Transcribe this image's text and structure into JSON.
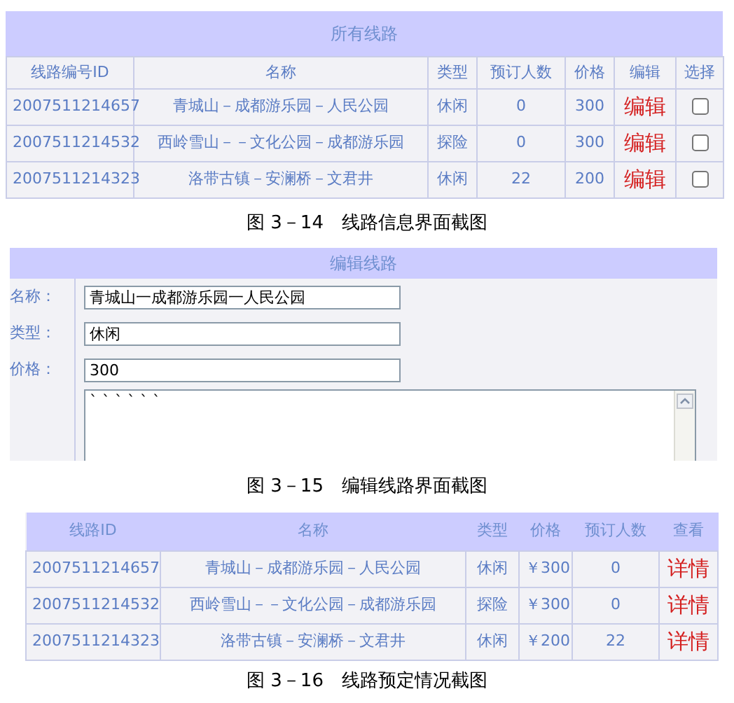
{
  "routes_panel": {
    "title": "所有线路",
    "columns": [
      "线路编号ID",
      "名称",
      "类型",
      "预订人数",
      "价格",
      "编辑",
      "选择"
    ],
    "rows": [
      {
        "id": "2007511214657",
        "name": "青城山－成都游乐园－人民公园",
        "type": "休闲",
        "count": "0",
        "price": "300",
        "action": "编辑",
        "checked": false
      },
      {
        "id": "2007511214532",
        "name": "西岭雪山－－文化公园－成都游乐园",
        "type": "探险",
        "count": "0",
        "price": "300",
        "action": "编辑",
        "checked": false
      },
      {
        "id": "2007511214323",
        "name": "洛带古镇－安澜桥－文君井",
        "type": "休闲",
        "count": "22",
        "price": "200",
        "action": "编辑",
        "checked": false
      }
    ]
  },
  "routes_caption": "图 3－14　线路信息界面截图",
  "edit_panel": {
    "title": "编辑线路",
    "fields": [
      {
        "label": "名称：",
        "value": "青城山一成都游乐园一人民公园"
      },
      {
        "label": "类型：",
        "value": "休闲"
      },
      {
        "label": "价格：",
        "value": "300"
      }
    ],
    "description": "` ` ` ` ` `"
  },
  "edit_caption": "图 3－15　编辑线路界面截图",
  "booking_panel": {
    "columns": [
      "线路ID",
      "名称",
      "类型",
      "价格",
      "预订人数",
      "查看"
    ],
    "rows": [
      {
        "id": "2007511214657",
        "name": "青城山－成都游乐园－人民公园",
        "type": "休闲",
        "price": "￥300",
        "count": "0",
        "action": "详情"
      },
      {
        "id": "2007511214532",
        "name": "西岭雪山－－文化公园－成都游乐园",
        "type": "探险",
        "price": "￥300",
        "count": "0",
        "action": "详情"
      },
      {
        "id": "2007511214323",
        "name": "洛带古镇－安澜桥－文君井",
        "type": "休闲",
        "price": "￥200",
        "count": "22",
        "action": "详情"
      }
    ]
  },
  "booking_caption": "图 3－16　线路预定情况截图"
}
